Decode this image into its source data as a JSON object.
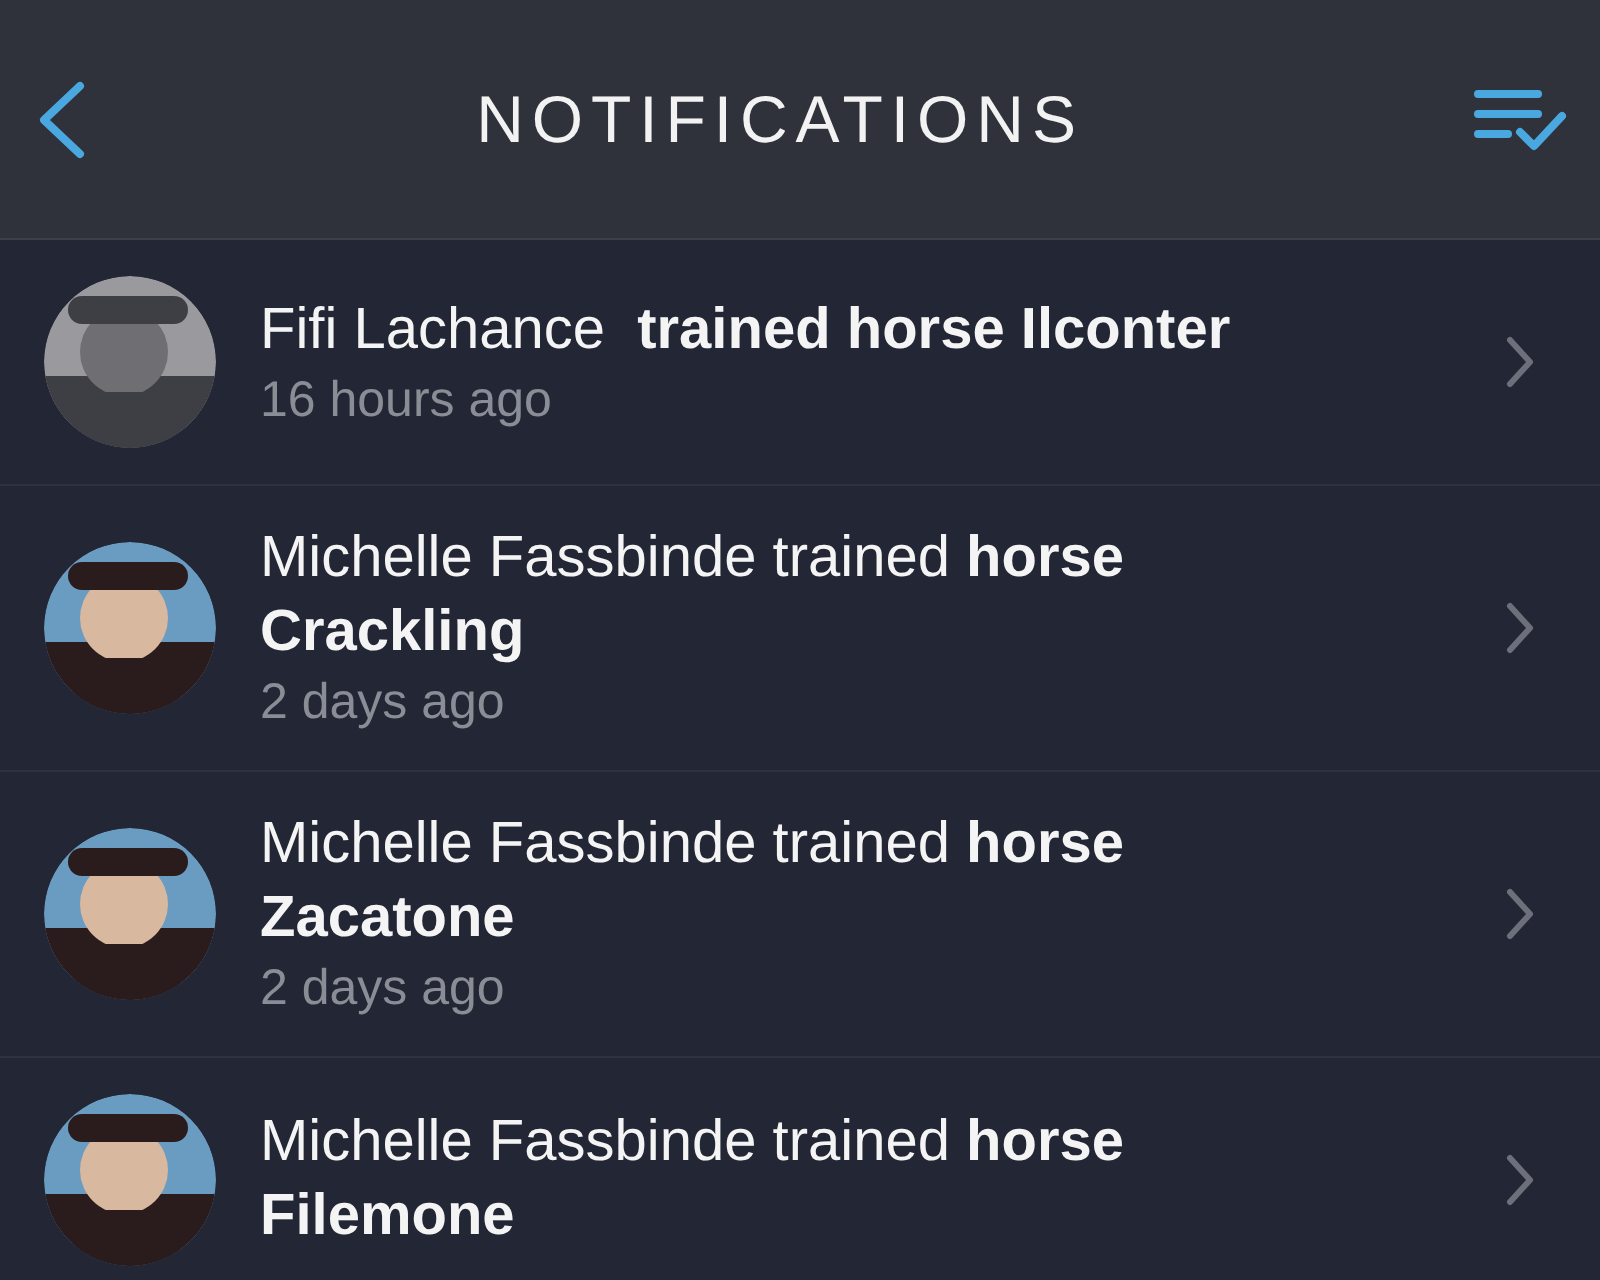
{
  "header": {
    "title": "NOTIFICATIONS"
  },
  "notifications": [
    {
      "message": "Fifi Lachance  **trained horse Ilconter**",
      "time": "16 hours ago"
    },
    {
      "message": "Michelle Fassbinde trained **horse Crackling**",
      "time": "2 days ago"
    },
    {
      "message": "Michelle Fassbinde trained **horse Zacatone**",
      "time": "2 days ago"
    },
    {
      "message": "Michelle Fassbinde trained **horse Filemone**"
    }
  ]
}
